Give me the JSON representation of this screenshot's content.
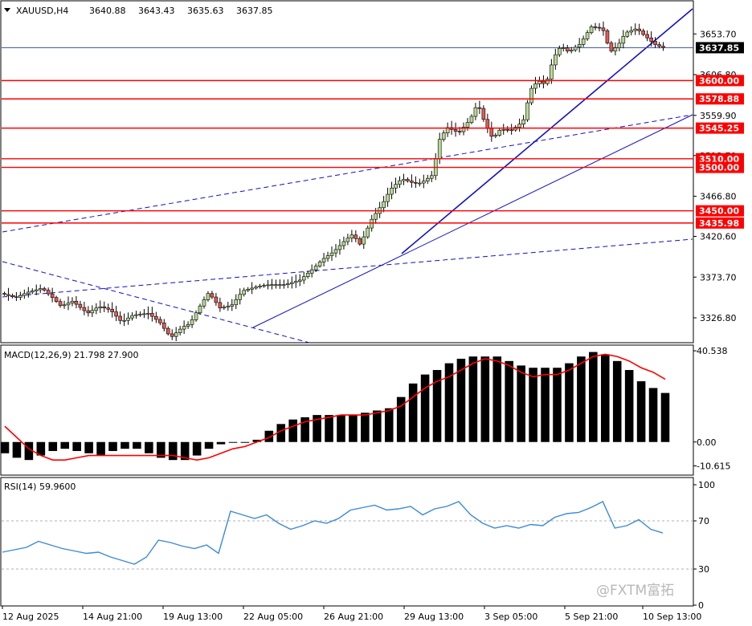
{
  "header": {
    "symbol": "XAUUSD,H4",
    "open": "3640.88",
    "high": "3643.43",
    "low": "3635.63",
    "close": "3637.85"
  },
  "watermark": "@FXTM富拓",
  "colors": {
    "bull_candle": "#b7d991",
    "bear_candle": "#e05a52",
    "level_line": "#ff0000",
    "trend_line": "#1010c8",
    "macd_signal": "#ff0000",
    "rsi_line": "#3c8ad8"
  },
  "chart_data": [
    {
      "type": "candlestick",
      "name": "price",
      "ylim": [
        3300,
        3690
      ],
      "y_ticks": [
        "3653.70",
        "3606.80",
        "3559.90",
        "3513.70",
        "3466.80",
        "3420.60",
        "3373.70",
        "3326.80"
      ],
      "current_price": "3637.85",
      "levels": [
        "3600.00",
        "3578.88",
        "3545.25",
        "3510.00",
        "3500.00",
        "3450.00",
        "3435.98"
      ],
      "x_tick_labels": [
        "12 Aug 2025",
        "14 Aug 21:00",
        "19 Aug 13:00",
        "22 Aug 05:00",
        "26 Aug 21:00",
        "29 Aug 13:00",
        "3 Sep 05:00",
        "5 Sep 21:00",
        "10 Sep 13:00"
      ],
      "close_path": [
        [
          0,
          3355
        ],
        [
          8,
          3350
        ],
        [
          14,
          3356
        ],
        [
          22,
          3361
        ],
        [
          28,
          3349
        ],
        [
          32,
          3340
        ],
        [
          38,
          3346
        ],
        [
          46,
          3332
        ],
        [
          52,
          3340
        ],
        [
          58,
          3336
        ],
        [
          64,
          3322
        ],
        [
          70,
          3330
        ],
        [
          78,
          3332
        ],
        [
          84,
          3322
        ],
        [
          90,
          3304
        ],
        [
          96,
          3316
        ],
        [
          100,
          3320
        ],
        [
          105,
          3339
        ],
        [
          110,
          3356
        ],
        [
          116,
          3338
        ],
        [
          122,
          3341
        ],
        [
          128,
          3358
        ],
        [
          136,
          3363
        ],
        [
          142,
          3365
        ],
        [
          150,
          3365
        ],
        [
          158,
          3370
        ],
        [
          166,
          3385
        ],
        [
          170,
          3394
        ],
        [
          176,
          3403
        ],
        [
          182,
          3416
        ],
        [
          186,
          3423
        ],
        [
          190,
          3411
        ],
        [
          196,
          3440
        ],
        [
          202,
          3459
        ],
        [
          206,
          3475
        ],
        [
          212,
          3487
        ],
        [
          218,
          3482
        ],
        [
          222,
          3482
        ],
        [
          228,
          3491
        ],
        [
          232,
          3533
        ],
        [
          236,
          3546
        ],
        [
          242,
          3540
        ],
        [
          248,
          3555
        ],
        [
          252,
          3574
        ],
        [
          256,
          3550
        ],
        [
          260,
          3533
        ],
        [
          264,
          3544
        ],
        [
          270,
          3543
        ],
        [
          276,
          3553
        ],
        [
          280,
          3590
        ],
        [
          284,
          3600
        ],
        [
          288,
          3595
        ],
        [
          292,
          3626
        ],
        [
          296,
          3640
        ],
        [
          300,
          3633
        ],
        [
          306,
          3642
        ],
        [
          312,
          3662
        ],
        [
          318,
          3660
        ],
        [
          322,
          3633
        ],
        [
          326,
          3640
        ],
        [
          330,
          3655
        ],
        [
          336,
          3660
        ],
        [
          340,
          3652
        ],
        [
          346,
          3641
        ],
        [
          350,
          3638
        ]
      ],
      "x_range": [
        0,
        350
      ]
    },
    {
      "type": "bar+line",
      "name": "MACD(12,26,9)",
      "label": "MACD(12,26,9) 21.798 27.900",
      "ylim": [
        -14,
        42
      ],
      "y_ticks": [
        "40.538",
        "0.00",
        "-10.615"
      ],
      "macd_values": [
        -5,
        -7,
        -8,
        -6,
        -4,
        -3,
        -4,
        -5,
        -6,
        -4,
        -3,
        -3,
        -5,
        -7,
        -8,
        -8,
        -6,
        -3,
        -1,
        0,
        0,
        1,
        5,
        8,
        10,
        11,
        12,
        12,
        12,
        12,
        13,
        14,
        15,
        20,
        26,
        30,
        32,
        35,
        37,
        38,
        38,
        38,
        36,
        34,
        33,
        33,
        33,
        35,
        38,
        40,
        39,
        36,
        32,
        27,
        24,
        21.798
      ],
      "signal_values": [
        7,
        2,
        -3,
        -6,
        -8,
        -8,
        -7,
        -6,
        -6,
        -6,
        -6,
        -6,
        -6,
        -6,
        -6,
        -7,
        -8,
        -7,
        -5,
        -3,
        -2,
        0,
        2,
        5,
        7,
        9,
        10,
        11,
        12,
        12,
        12,
        13,
        14,
        16,
        20,
        24,
        27,
        29,
        32,
        35,
        37,
        36,
        34,
        31,
        29,
        30,
        30,
        32,
        35,
        38,
        39,
        38,
        36,
        33,
        31,
        27.9
      ]
    },
    {
      "type": "line",
      "name": "RSI(14)",
      "label": "RSI(14) 59.9600",
      "ylim": [
        0,
        100
      ],
      "y_ticks": [
        "100",
        "70",
        "30",
        "0"
      ],
      "levels": [
        70,
        30
      ],
      "values": [
        44,
        46,
        48,
        53,
        50,
        47,
        45,
        43,
        44,
        40,
        37,
        34,
        40,
        54,
        52,
        49,
        47,
        50,
        43,
        78,
        75,
        72,
        75,
        68,
        63,
        66,
        70,
        68,
        72,
        79,
        81,
        83,
        79,
        80,
        82,
        75,
        80,
        82,
        86,
        75,
        68,
        64,
        66,
        64,
        67,
        66,
        73,
        76,
        77,
        81,
        86,
        64,
        66,
        71,
        63,
        59.96
      ]
    }
  ]
}
